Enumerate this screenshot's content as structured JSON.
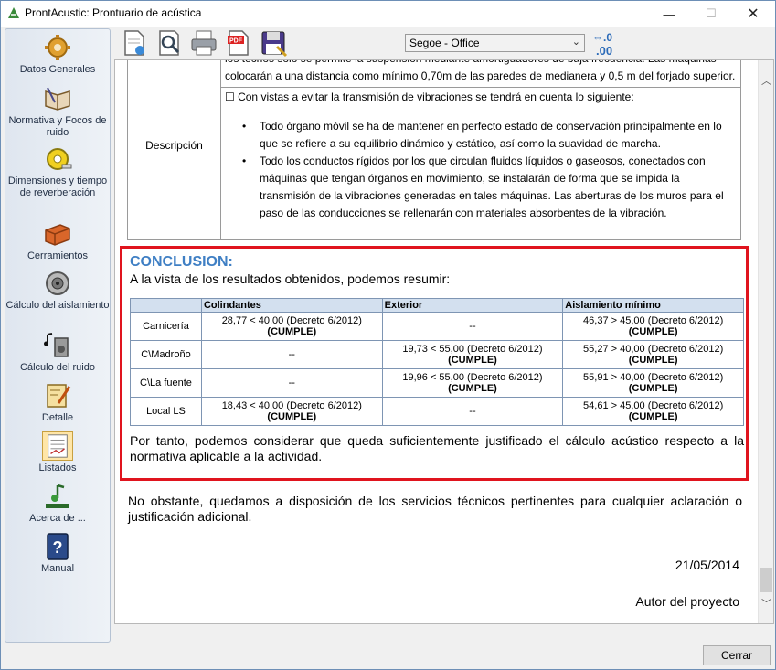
{
  "window": {
    "title": "ProntAcustic: Prontuario de acústica",
    "minimize": "—",
    "maximize": "☐",
    "close": "✕"
  },
  "sidebar": {
    "items": [
      {
        "label": "Datos Generales",
        "icon": "gear-icon"
      },
      {
        "label": "Normativa y Focos de ruido",
        "icon": "book-icon"
      },
      {
        "label": "Dimensiones y tiempo de reverberación",
        "icon": "tape-measure-icon"
      },
      {
        "label": "Cerramientos",
        "icon": "brick-icon"
      },
      {
        "label": "Cálculo del aislamiento",
        "icon": "speaker-icon"
      },
      {
        "label": "Cálculo del ruido",
        "icon": "music-speaker-icon"
      },
      {
        "label": "Detalle",
        "icon": "detail-icon"
      },
      {
        "label": "Listados",
        "icon": "listing-icon"
      },
      {
        "label": "Acerca de ...",
        "icon": "about-icon"
      },
      {
        "label": "Manual",
        "icon": "help-book-icon"
      }
    ]
  },
  "toolbar": {
    "font_value": "Segoe - Office",
    "decimals_label_top": "⇔.0",
    "decimals_label_bottom": ".00"
  },
  "description": {
    "label": "Descripción",
    "line1": "los techos sólo se permite la suspensión mediante amortiguadores de baja frecuencia. Las máquinas colocarán a una distancia como mínimo 0,70m de las paredes de medianera y 0,5 m del forjado superior.",
    "check_text": "☐ Con vistas a evitar la transmisión de vibraciones se tendrá en cuenta lo siguiente:",
    "bullets": [
      "Todo órgano móvil se ha de mantener en perfecto estado de conservación principalmente en lo que se refiere a su equilibrio dinámico y estático, así como la suavidad de marcha.",
      "Todo los conductos rígidos por los que circulan fluidos líquidos o gaseosos, conectados con máquinas que tengan órganos en movimiento, se instalarán de forma que se impida la transmisión de la vibraciones generadas en tales máquinas. Las aberturas de los muros para el paso de las conducciones se rellenarán con materiales absorbentes de la vibración."
    ]
  },
  "conclusion": {
    "title": "CONCLUSION:",
    "intro": "A la vista de los resultados obtenidos, podemos resumir:",
    "columns": [
      "",
      "Colindantes",
      "Exterior",
      "Aislamiento mínimo"
    ],
    "rows": [
      {
        "name": "Carnicería",
        "colindantes": "28,77 < 40,00 (Decreto 6/2012)",
        "colindantes_ok": "(CUMPLE)",
        "exterior": "--",
        "exterior_ok": "",
        "aislamiento": "46,37 > 45,00 (Decreto 6/2012)",
        "aislamiento_ok": "(CUMPLE)"
      },
      {
        "name": "C\\Madroño",
        "colindantes": "--",
        "colindantes_ok": "",
        "exterior": "19,73 < 55,00 (Decreto 6/2012)",
        "exterior_ok": "(CUMPLE)",
        "aislamiento": "55,27 > 40,00 (Decreto 6/2012)",
        "aislamiento_ok": "(CUMPLE)"
      },
      {
        "name": "C\\La fuente",
        "colindantes": "--",
        "colindantes_ok": "",
        "exterior": "19,96 < 55,00 (Decreto 6/2012)",
        "exterior_ok": "(CUMPLE)",
        "aislamiento": "55,91 > 40,00 (Decreto 6/2012)",
        "aislamiento_ok": "(CUMPLE)"
      },
      {
        "name": "Local LS",
        "colindantes": "18,43 < 40,00 (Decreto 6/2012)",
        "colindantes_ok": "(CUMPLE)",
        "exterior": "--",
        "exterior_ok": "",
        "aislamiento": "54,61 > 45,00 (Decreto 6/2012)",
        "aislamiento_ok": "(CUMPLE)"
      }
    ],
    "footer": "Por tanto, podemos considerar que queda suficientemente justificado el cálculo acústico respecto a la normativa aplicable a la actividad."
  },
  "closing": {
    "text": "No obstante, quedamos a disposición de los servicios técnicos pertinentes para cualquier aclaración o justificación adicional.",
    "date": "21/05/2014",
    "author": "Autor del proyecto"
  },
  "footer": {
    "close_label": "Cerrar"
  }
}
